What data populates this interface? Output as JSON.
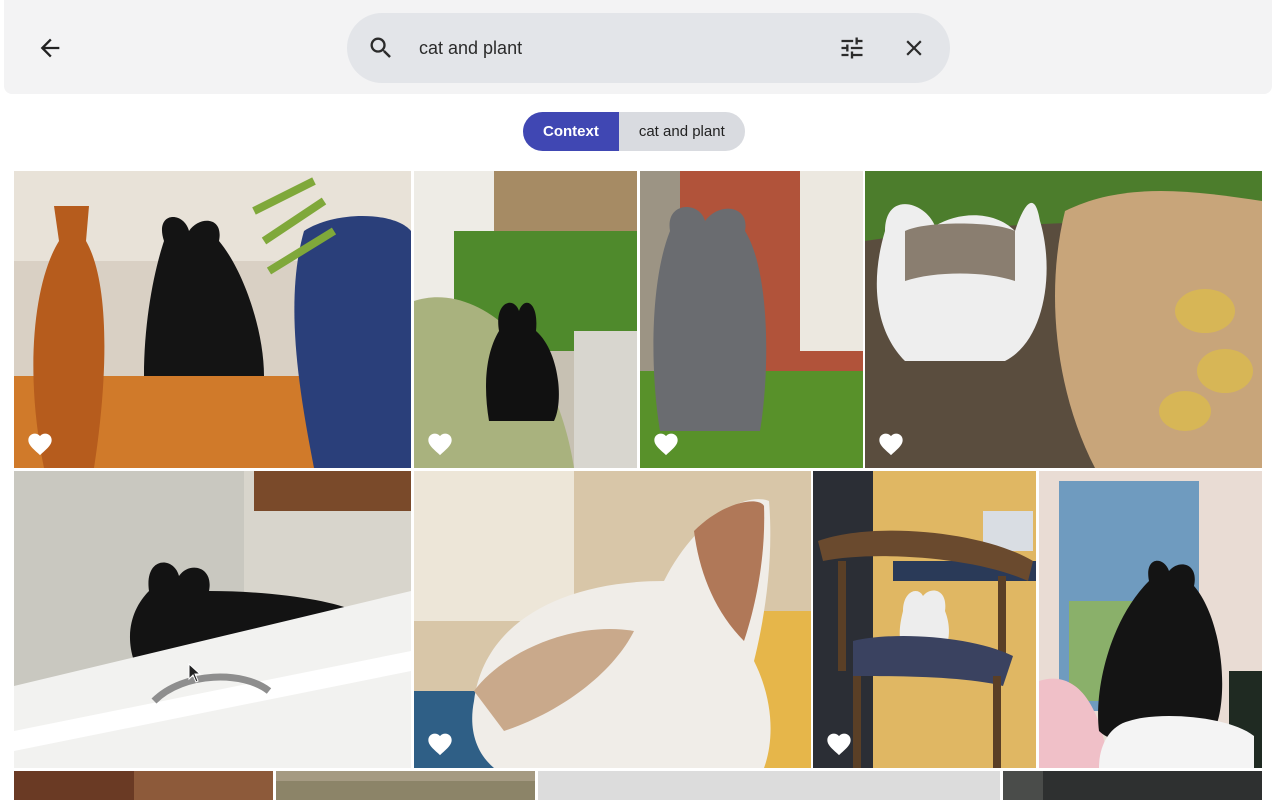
{
  "header": {
    "back_icon": "arrow-left-icon",
    "search_icon": "search-icon",
    "search_value": "cat and plant",
    "tune_icon": "tune-icon",
    "clear_icon": "close-icon"
  },
  "chips": {
    "primary_label": "Context",
    "secondary_label": "cat and plant",
    "accent": "#4047b3"
  },
  "photos": [
    {
      "name": "photo-black-cat-vase"
    },
    {
      "name": "photo-black-cat-grass"
    },
    {
      "name": "photo-grey-cat-brick"
    },
    {
      "name": "photo-tabby-cat-potatoes"
    },
    {
      "name": "photo-black-cat-windowsill"
    },
    {
      "name": "photo-cream-cat-closeup"
    },
    {
      "name": "photo-tabby-cat-chair"
    },
    {
      "name": "photo-black-cat-painting"
    },
    {
      "name": "photo-row3-a"
    },
    {
      "name": "photo-row3-b"
    },
    {
      "name": "photo-row3-c"
    },
    {
      "name": "photo-row3-d"
    }
  ]
}
